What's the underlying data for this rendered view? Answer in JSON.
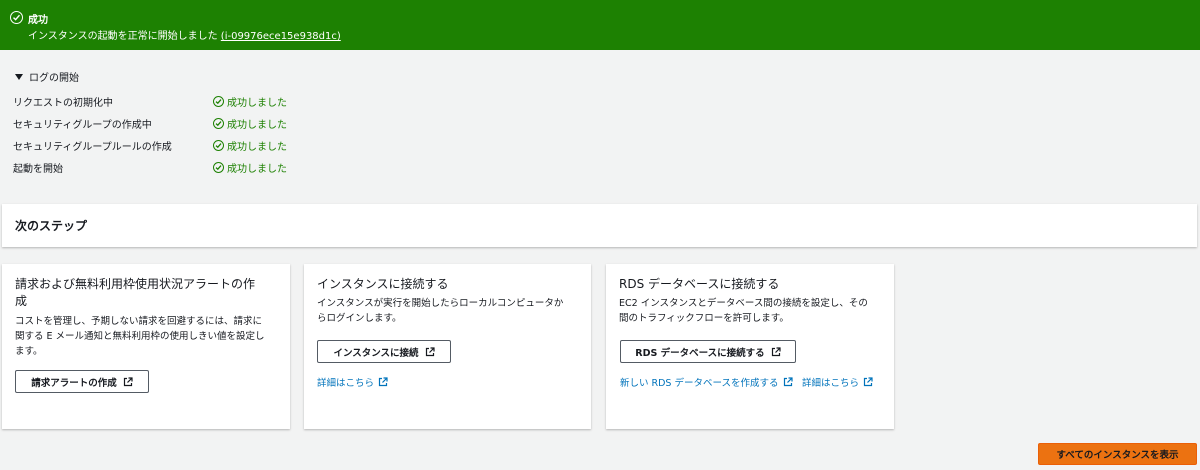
{
  "banner": {
    "title": "成功",
    "message": "インスタンスの起動を正常に開始しました",
    "instance_link": "(i-09976ece15e938d1c)"
  },
  "log": {
    "heading": "ログの開始",
    "rows": [
      {
        "label": "リクエストの初期化中",
        "status": "成功しました"
      },
      {
        "label": "セキュリティグループの作成中",
        "status": "成功しました"
      },
      {
        "label": "セキュリティグループルールの作成",
        "status": "成功しました"
      },
      {
        "label": "起動を開始",
        "status": "成功しました"
      }
    ]
  },
  "next_steps": {
    "heading": "次のステップ"
  },
  "cards": [
    {
      "title_line1": "請求および無料利用枠使用状況アラートの作",
      "title_line2": "成",
      "desc_lines": [
        "コストを管理し、予期しない請求を回避するには、請求に",
        "関する E メール通知と無料利用枠の使用しきい値を設定し",
        "ます。"
      ],
      "button": "請求アラートの作成"
    },
    {
      "title_line1": "インスタンスに接続する",
      "desc_lines": [
        "インスタンスが実行を開始したらローカルコンピュータか",
        "らログインします。"
      ],
      "button": "インスタンスに接続",
      "link": "詳細はこちら"
    },
    {
      "title_line1": "RDS データベースに接続する",
      "desc_lines": [
        "EC2 インスタンスとデータベース間の接続を設定し、その",
        "間のトラフィックフローを許可します。"
      ],
      "button": "RDS データベースに接続する",
      "link1": "新しい RDS データベースを作成する",
      "link2": "詳細はこちら"
    }
  ],
  "footer": {
    "view_all": "すべてのインスタンスを表示"
  },
  "colors": {
    "success": "#1d8102",
    "link": "#0073bb",
    "primary": "#ec7211"
  }
}
